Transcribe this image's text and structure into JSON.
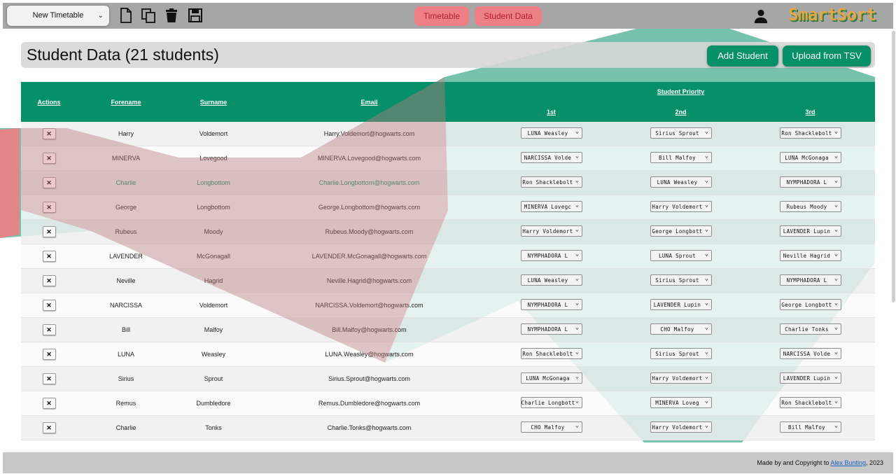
{
  "toolbar": {
    "timetable_select": "New Timetable",
    "nav": {
      "timetable": "Timetable",
      "student_data": "Student Data"
    },
    "brand": "SmartSort",
    "icons": [
      "new-file-icon",
      "duplicate-icon",
      "trash-icon",
      "save-icon",
      "user-icon"
    ]
  },
  "page": {
    "title": "Student Data (21 students)",
    "add_student": "Add Student",
    "upload": "Upload from TSV"
  },
  "table": {
    "headers": {
      "actions": "Actions",
      "forename": "Forename",
      "surname": "Surname",
      "email": "Email",
      "priority": "Student Priority",
      "first": "1st",
      "second": "2nd",
      "third": "3rd"
    },
    "remove_label": "✕",
    "rows": [
      {
        "forename": "Harry",
        "surname": "Voldemort",
        "email": "Harry.Voldemort@hogwarts.com",
        "p1": "LUNA Weasley",
        "p2": "Sirius Sprout",
        "p3": "Ron Shacklebolt"
      },
      {
        "forename": "MINERVA",
        "surname": "Lovegood",
        "email": "MINERVA.Lovegood@hogwarts.com",
        "p1": "NARCISSA Volde",
        "p2": "Bill Malfoy",
        "p3": "LUNA McGonaga"
      },
      {
        "forename": "Charlie",
        "surname": "Longbottom",
        "email": "Charlie.Longbottom@hogwarts.com",
        "p1": "Ron Shacklebolt",
        "p2": "LUNA Weasley",
        "p3": "NYMPHADORA L"
      },
      {
        "forename": "George",
        "surname": "Longbottom",
        "email": "George.Longbottom@hogwarts.com",
        "p1": "MINERVA Lovegc",
        "p2": "Harry Voldemort",
        "p3": "Rubeus Moody"
      },
      {
        "forename": "Rubeus",
        "surname": "Moody",
        "email": "Rubeus.Moody@hogwarts.com",
        "p1": "Harry Voldemort",
        "p2": "George Longbott",
        "p3": "LAVENDER Lupin"
      },
      {
        "forename": "LAVENDER",
        "surname": "McGonagall",
        "email": "LAVENDER.McGonagall@hogwarts.com",
        "p1": "NYMPHADORA L",
        "p2": "LUNA Sprout",
        "p3": "Neville Hagrid"
      },
      {
        "forename": "Neville",
        "surname": "Hagrid",
        "email": "Neville.Hagrid@hogwarts.com",
        "p1": "LUNA Weasley",
        "p2": "Sirius Sprout",
        "p3": "NYMPHADORA L"
      },
      {
        "forename": "NARCISSA",
        "surname": "Voldemort",
        "email": "NARCISSA.Voldemort@hogwarts.com",
        "p1": "NYMPHADORA L",
        "p2": "LAVENDER Lupin",
        "p3": "George Longbott"
      },
      {
        "forename": "Bill",
        "surname": "Malfoy",
        "email": "Bill.Malfoy@hogwarts.com",
        "p1": "NYMPHADORA L",
        "p2": "CHO Malfoy",
        "p3": "Charlie Tonks"
      },
      {
        "forename": "LUNA",
        "surname": "Weasley",
        "email": "LUNA.Weasley@hogwarts.com",
        "p1": "Ron Shacklebolt",
        "p2": "Sirius Sprout",
        "p3": "NARCISSA Volde"
      },
      {
        "forename": "Sirius",
        "surname": "Sprout",
        "email": "Sirius.Sprout@hogwarts.com",
        "p1": "LUNA McGonaga",
        "p2": "Harry Voldemort",
        "p3": "LAVENDER Lupin"
      },
      {
        "forename": "Remus",
        "surname": "Dumbledore",
        "email": "Remus.Dumbledore@hogwarts.com",
        "p1": "Charlie Longbott",
        "p2": "MINERVA Loveg",
        "p3": "Ron Shacklebolt"
      },
      {
        "forename": "Charlie",
        "surname": "Tonks",
        "email": "Charlie.Tonks@hogwarts.com",
        "p1": "CHO Malfoy",
        "p2": "Harry Voldemort",
        "p3": "Bill Malfoy"
      }
    ],
    "highlight_color": "#0b8a63"
  },
  "footer": {
    "prefix": "Made by and Copyright to",
    "author": "Alex Bunting",
    "suffix": ", 2023"
  },
  "colors": {
    "green": "#069069",
    "pink": "#ee7f86",
    "nav_text": "#b1202c",
    "toolbar": "#a6a6a6",
    "footer": "#c8c8c8"
  }
}
